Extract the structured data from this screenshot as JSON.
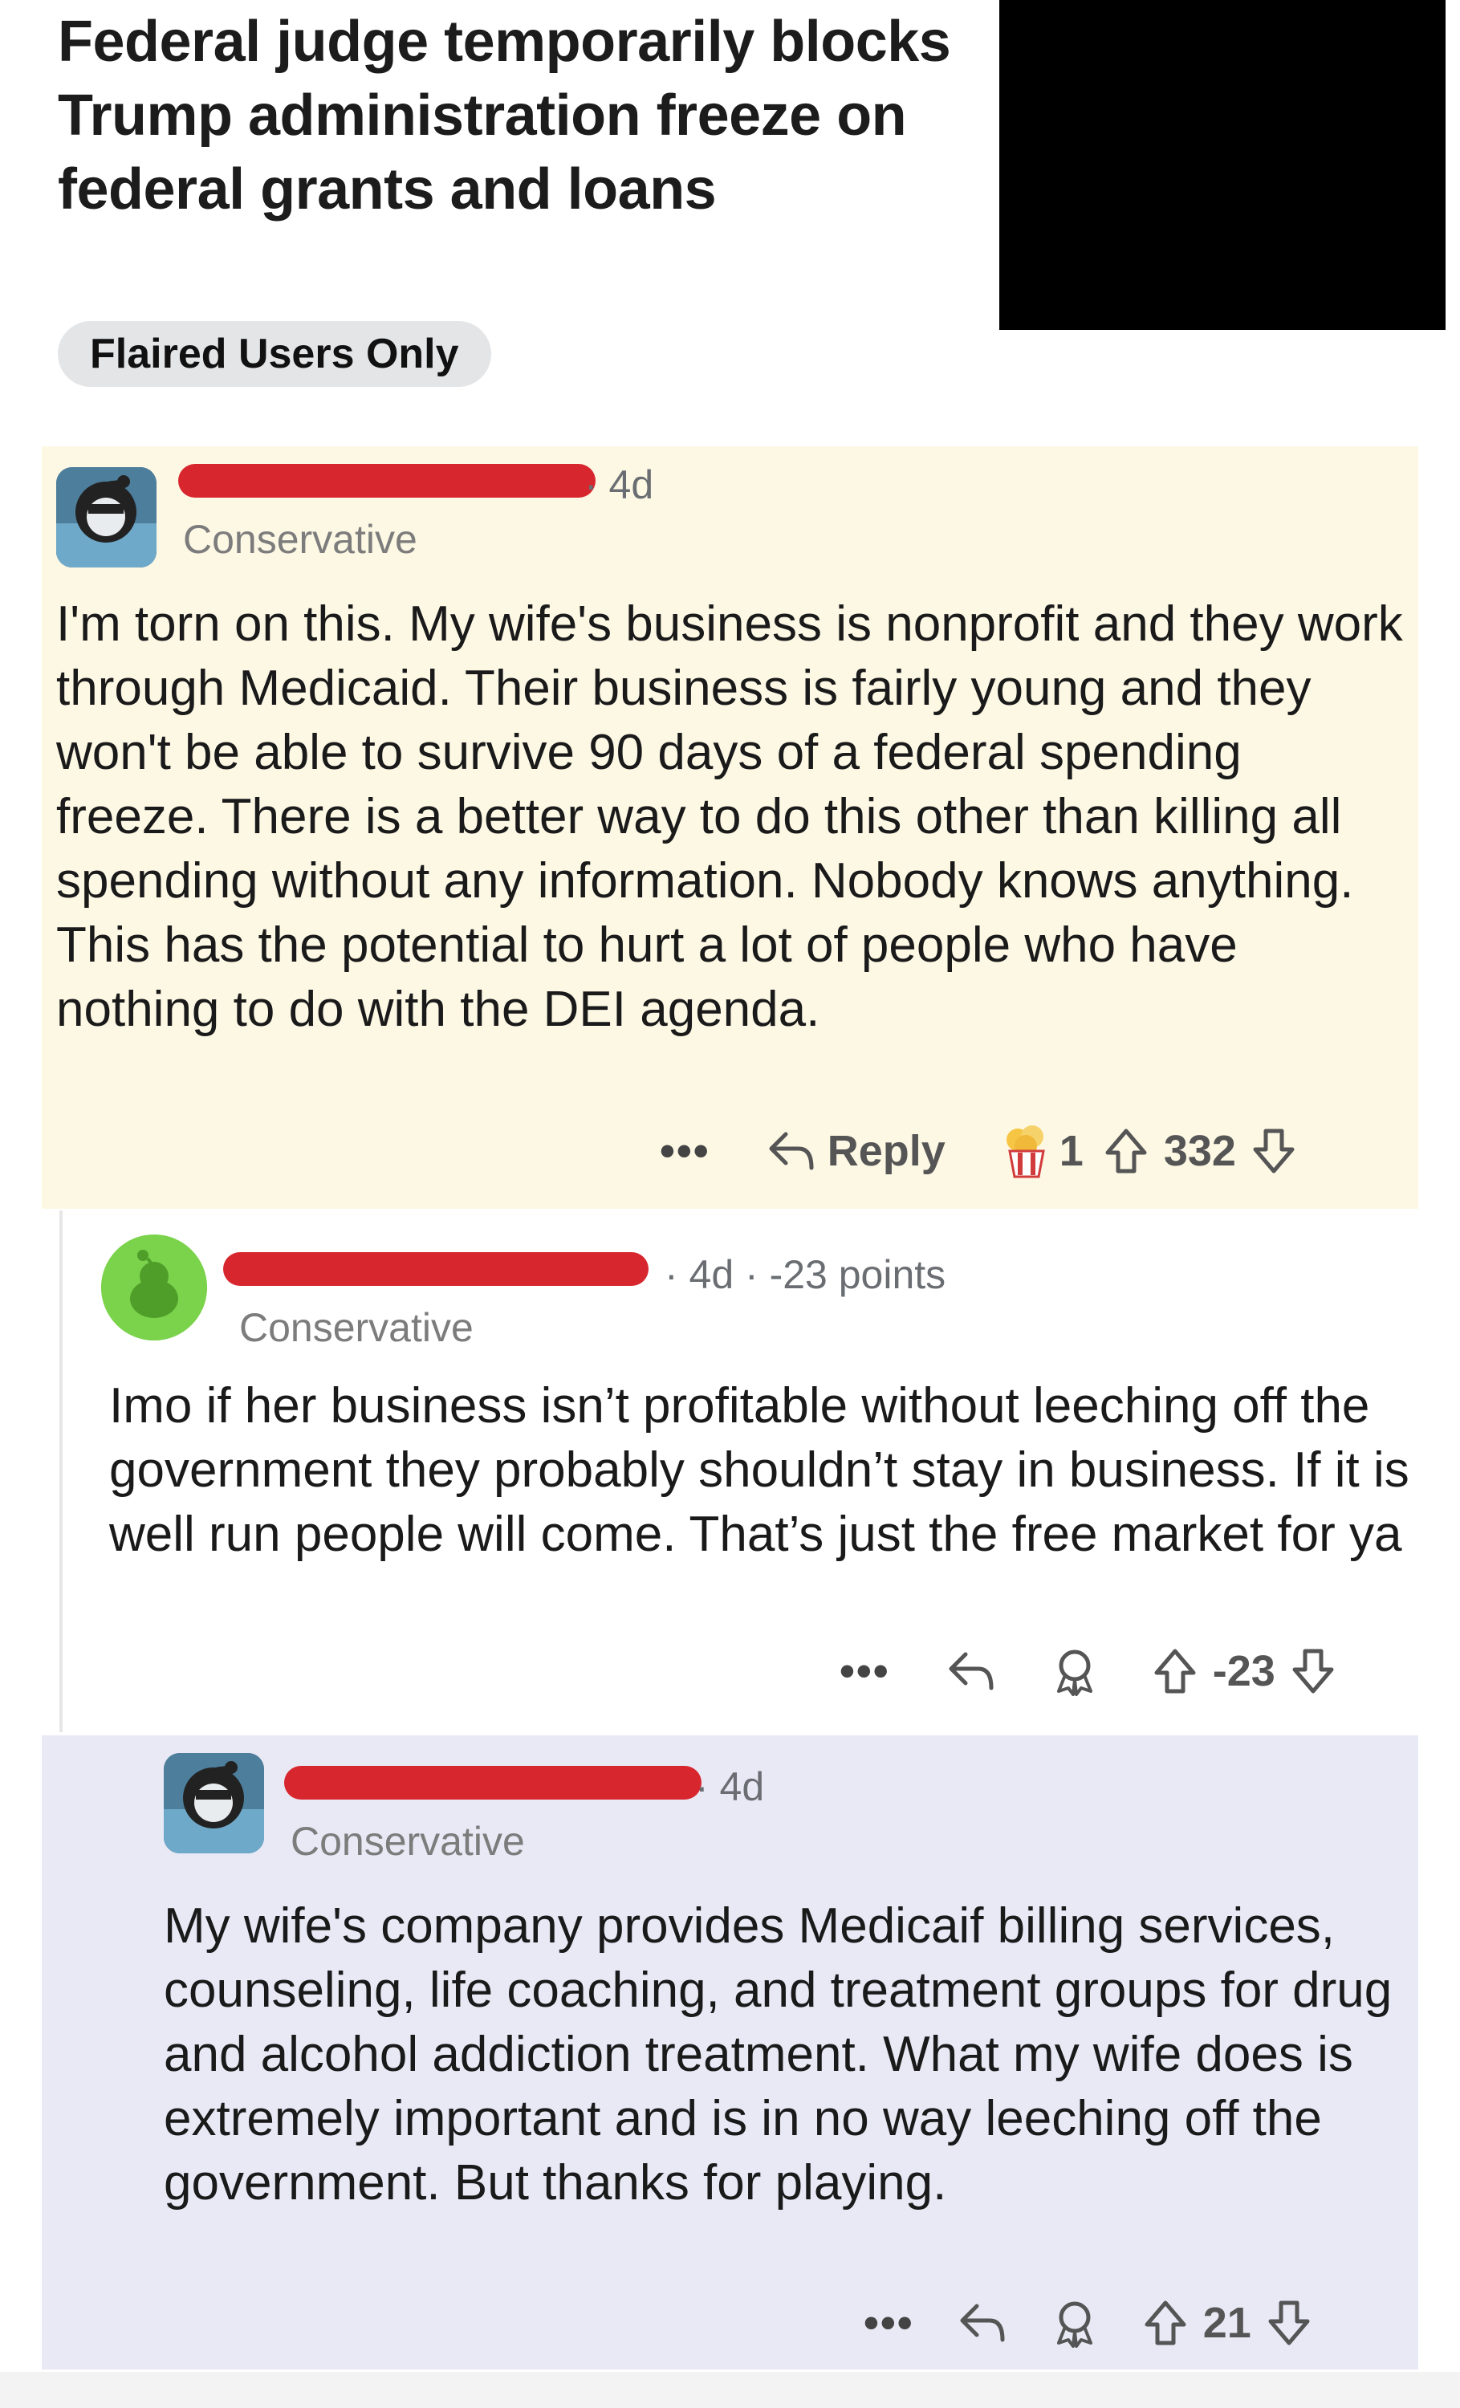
{
  "post": {
    "title": "Federal judge temporarily blocks Trump administration freeze on federal grants and loans",
    "flair": "Flaired Users Only"
  },
  "comments": [
    {
      "age": "· 4d",
      "user_flair": "Conservative",
      "body": "I'm torn on this. My wife's business is nonprofit and they work through Medicaid. Their business is fairly young and they won't be able to survive 90 days of a federal spending freeze. There is a better way to do this other than killing all spending without any information. Nobody knows anything.  This has the potential to hurt a lot of people who have nothing to do with the DEI agenda.",
      "actions": {
        "more": "•••",
        "reply_label": "Reply",
        "award_count": "1",
        "score": "332"
      }
    },
    {
      "age": "· 4d · -23 points",
      "user_flair": "Conservative",
      "body": "Imo if her business isn’t profitable without leeching off the government they probably shouldn’t stay in business. If it is well run people will come. That’s just the free market for ya",
      "actions": {
        "more": "•••",
        "score": "-23"
      }
    },
    {
      "age": "· 4d",
      "user_flair": "Conservative",
      "body": "My wife's company provides Medicaif billing services, counseling, life coaching, and treatment groups for drug and alcohol addiction treatment. What my wife does is extremely important and is in no way leeching off the government.  But thanks for playing.",
      "actions": {
        "more": "•••",
        "score": "21"
      }
    }
  ],
  "icons": [
    "robot-avatar-icon",
    "snoo-avatar-icon",
    "reply-arrow-icon",
    "popcorn-award-icon",
    "award-icon",
    "upvote-icon",
    "downvote-icon"
  ],
  "colors": {
    "highlight_yellow": "#fdf8e4",
    "highlight_lavender": "#e8e9f5",
    "redaction_red": "#d7262e",
    "pill_gray": "#e4e5e7"
  }
}
